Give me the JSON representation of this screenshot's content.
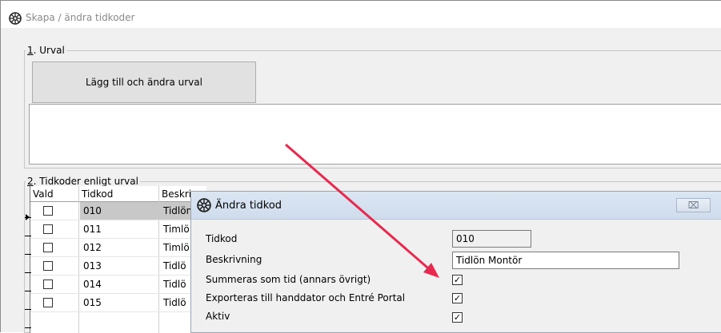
{
  "window": {
    "title": "Skapa / ändra tidkoder"
  },
  "section1": {
    "label_num": "1",
    "label_text": ". Urval",
    "button_label": "Lägg till och ändra urval"
  },
  "section2": {
    "label_num": "2",
    "label_text": ". Tidkoder enligt urval",
    "columns": [
      "Vald",
      "Tidkod",
      "Beskri"
    ],
    "rows": [
      {
        "tidkod": "010",
        "beskrivning": "Tidlön",
        "selected": true
      },
      {
        "tidkod": "011",
        "beskrivning": "Timlö",
        "selected": false
      },
      {
        "tidkod": "012",
        "beskrivning": "Timlö",
        "selected": false
      },
      {
        "tidkod": "013",
        "beskrivning": "Tidlö",
        "selected": false
      },
      {
        "tidkod": "014",
        "beskrivning": "Tidlö",
        "selected": false
      },
      {
        "tidkod": "015",
        "beskrivning": "Tidlö",
        "selected": false
      }
    ]
  },
  "dialog": {
    "title": "Ändra tidkod",
    "close_label": "⌧",
    "fields": {
      "tidkod_label": "Tidkod",
      "tidkod_value": "010",
      "beskrivning_label": "Beskrivning",
      "beskrivning_value": "Tidlön Montör",
      "summeras_label": "Summeras som tid (annars övrigt)",
      "summeras_checked": true,
      "exporteras_label": "Exporteras till handdator och Entré Portal",
      "exporteras_checked": true,
      "aktiv_label": "Aktiv",
      "aktiv_checked": true
    }
  },
  "annotation": {
    "arrow_color": "#e8294f"
  },
  "icons": {
    "app_logo": "app-logo-icon",
    "row_pointer": "row-pointer-icon",
    "checkmark": "checkmark-icon",
    "close": "close-icon"
  }
}
